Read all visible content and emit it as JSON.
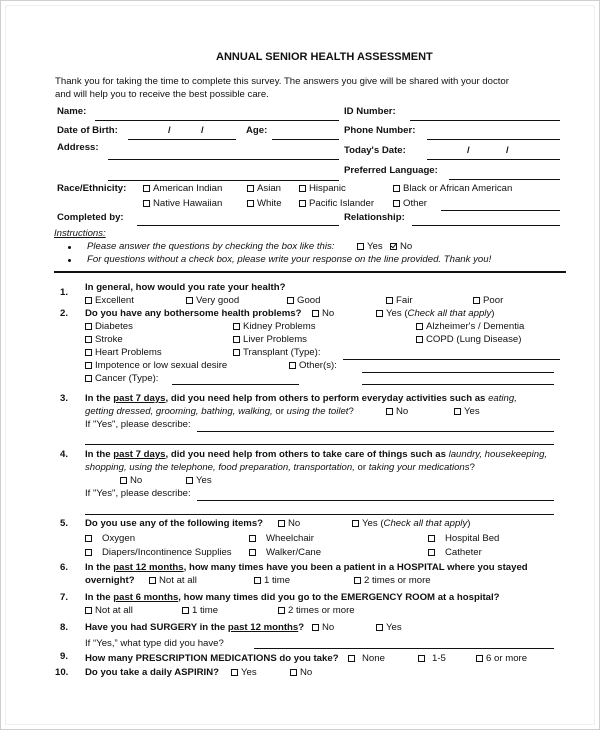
{
  "form": {
    "title": "ANNUAL SENIOR HEALTH ASSESSMENT",
    "intro_line1": "Thank you for taking the time to complete this survey. The answers you give will be shared with your doctor",
    "intro_line2": "and will help you to receive the best possible care.",
    "fields": {
      "name": "Name:",
      "id_number": "ID Number:",
      "dob": "Date of Birth:",
      "age": "Age:",
      "phone": "Phone Number:",
      "address": "Address:",
      "todays_date": "Today's Date:",
      "preferred_language": "Preferred Language:",
      "race": "Race/Ethnicity:",
      "completed_by": "Completed by:",
      "relationship": "Relationship:",
      "date_sep": "/"
    },
    "race_options": [
      "American Indian",
      "Asian",
      "Hispanic",
      "Black or African American",
      "Native Hawaiian",
      "White",
      "Pacific Islander",
      "Other"
    ],
    "instructions": {
      "heading": "Instructions:",
      "item1": "Please answer the questions by checking the box like this:",
      "example_yes": "Yes",
      "example_no": "No",
      "item2": "For questions without a check box, please write your response on the line provided. Thank you!"
    }
  },
  "questions": {
    "q1": {
      "num": "1.",
      "text": "In general, how would you rate your health?",
      "options": [
        "Excellent",
        "Very good",
        "Good",
        "Fair",
        "Poor"
      ]
    },
    "q2": {
      "num": "2.",
      "text": "Do you have any bothersome health problems?",
      "no": "No",
      "yes": "Yes (",
      "yes_italic": "Check all that apply",
      "yes_end": ")",
      "options": [
        "Diabetes",
        "Kidney Problems",
        "Alzheimer's / Dementia",
        "Stroke",
        "Liver Problems",
        "COPD (Lung Disease)",
        "Heart Problems",
        "Transplant (Type):",
        "Impotence or low sexual desire",
        "Other(s):",
        "Cancer (Type):"
      ]
    },
    "q3": {
      "num": "3.",
      "text_a": "In the ",
      "text_u": "past 7 days",
      "text_b": ", did you need help from others to perform everyday activities such as ",
      "text_i1": "eating,",
      "text_i2": "getting dressed, grooming, bathing, walking,",
      "text_c": " or ",
      "text_i3": "using the toilet",
      "text_d": "?",
      "no": "No",
      "yes": "Yes",
      "describe": "If \"Yes\", please describe:"
    },
    "q4": {
      "num": "4.",
      "text_a": "In the ",
      "text_u": "past 7 days",
      "text_b": ", did you need help from others to take care of things such as ",
      "text_i1": "laundry, housekeeping,",
      "text_i2": "shopping, using the telephone, food preparation, transportation,",
      "text_c": " or ",
      "text_i3": "taking your medications",
      "text_d": "?",
      "no": "No",
      "yes": "Yes",
      "describe": "If \"Yes\", please describe:"
    },
    "q5": {
      "num": "5.",
      "text": "Do you use any of the following items?",
      "no": "No",
      "yes": "Yes (",
      "yes_italic": "Check all that apply",
      "yes_end": ")",
      "options": [
        "Oxygen",
        "Wheelchair",
        "Hospital Bed",
        "Diapers/Incontinence Supplies",
        "Walker/Cane",
        "Catheter"
      ]
    },
    "q6": {
      "num": "6.",
      "text_a": "In the ",
      "text_u": "past 12 months",
      "text_b": ", how many times have you been a patient in a HOSPITAL where you stayed",
      "text_c": "overnight?",
      "options": [
        "Not at all",
        "1 time",
        "2 times or more"
      ]
    },
    "q7": {
      "num": "7.",
      "text_a": "In the ",
      "text_u": "past 6 months",
      "text_b": ", how many times did you go to the EMERGENCY ROOM at a hospital?",
      "options": [
        "Not at all",
        "1 time",
        "2 times or more"
      ]
    },
    "q8": {
      "num": "8.",
      "text_a": "Have you had SURGERY in the ",
      "text_u": "past 12 months",
      "text_b": "?",
      "no": "No",
      "yes": "Yes",
      "followup": "If “Yes,” what type did you have?"
    },
    "q9": {
      "num": "9.",
      "text": "How many PRESCRIPTION MEDICATIONS do you take?",
      "options": [
        "None",
        "1-5",
        "6 or more"
      ]
    },
    "q10": {
      "num": "10.",
      "text": "Do you take a daily ASPIRIN?",
      "options": [
        "Yes",
        "No"
      ]
    }
  }
}
